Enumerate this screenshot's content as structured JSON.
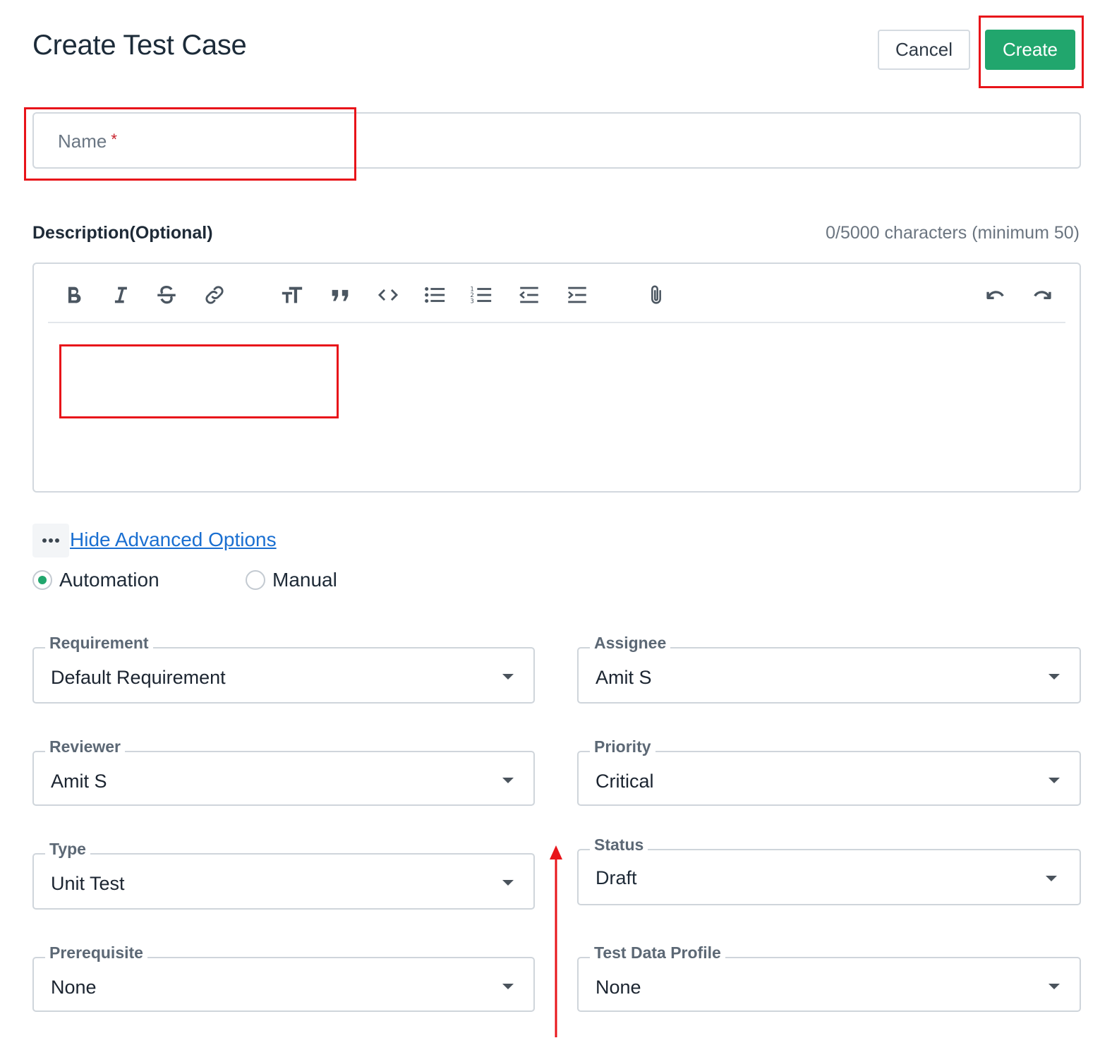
{
  "header": {
    "title": "Create Test Case",
    "cancel_label": "Cancel",
    "create_label": "Create"
  },
  "name_field": {
    "label": "Name",
    "required_mark": "*"
  },
  "description": {
    "label": "Description(Optional)",
    "char_count": "0/5000 characters (minimum 50)",
    "toolbar": [
      "bold-icon",
      "italic-icon",
      "strikethrough-icon",
      "link-icon",
      "text-size-icon",
      "quote-icon",
      "code-icon",
      "bulleted-list-icon",
      "numbered-list-icon",
      "outdent-icon",
      "indent-icon",
      "attachment-icon",
      "undo-icon",
      "redo-icon"
    ]
  },
  "advanced": {
    "toggle_label": "Hide Advanced Options"
  },
  "test_mode": {
    "automation_label": "Automation",
    "manual_label": "Manual",
    "selected": "Automation"
  },
  "fields": {
    "requirement": {
      "label": "Requirement",
      "value": "Default Requirement"
    },
    "assignee": {
      "label": "Assignee",
      "value": "Amit S"
    },
    "reviewer": {
      "label": "Reviewer",
      "value": "Amit S"
    },
    "priority": {
      "label": "Priority",
      "value": "Critical"
    },
    "type": {
      "label": "Type",
      "value": "Unit Test"
    },
    "status": {
      "label": "Status",
      "value": "Draft"
    },
    "prerequisite": {
      "label": "Prerequisite",
      "value": "None"
    },
    "test_data_profile": {
      "label": "Test Data Profile",
      "value": "None"
    }
  },
  "colors": {
    "primary_green": "#21a66d",
    "link_blue": "#1a6fd1",
    "highlight_red": "#e8141a"
  }
}
